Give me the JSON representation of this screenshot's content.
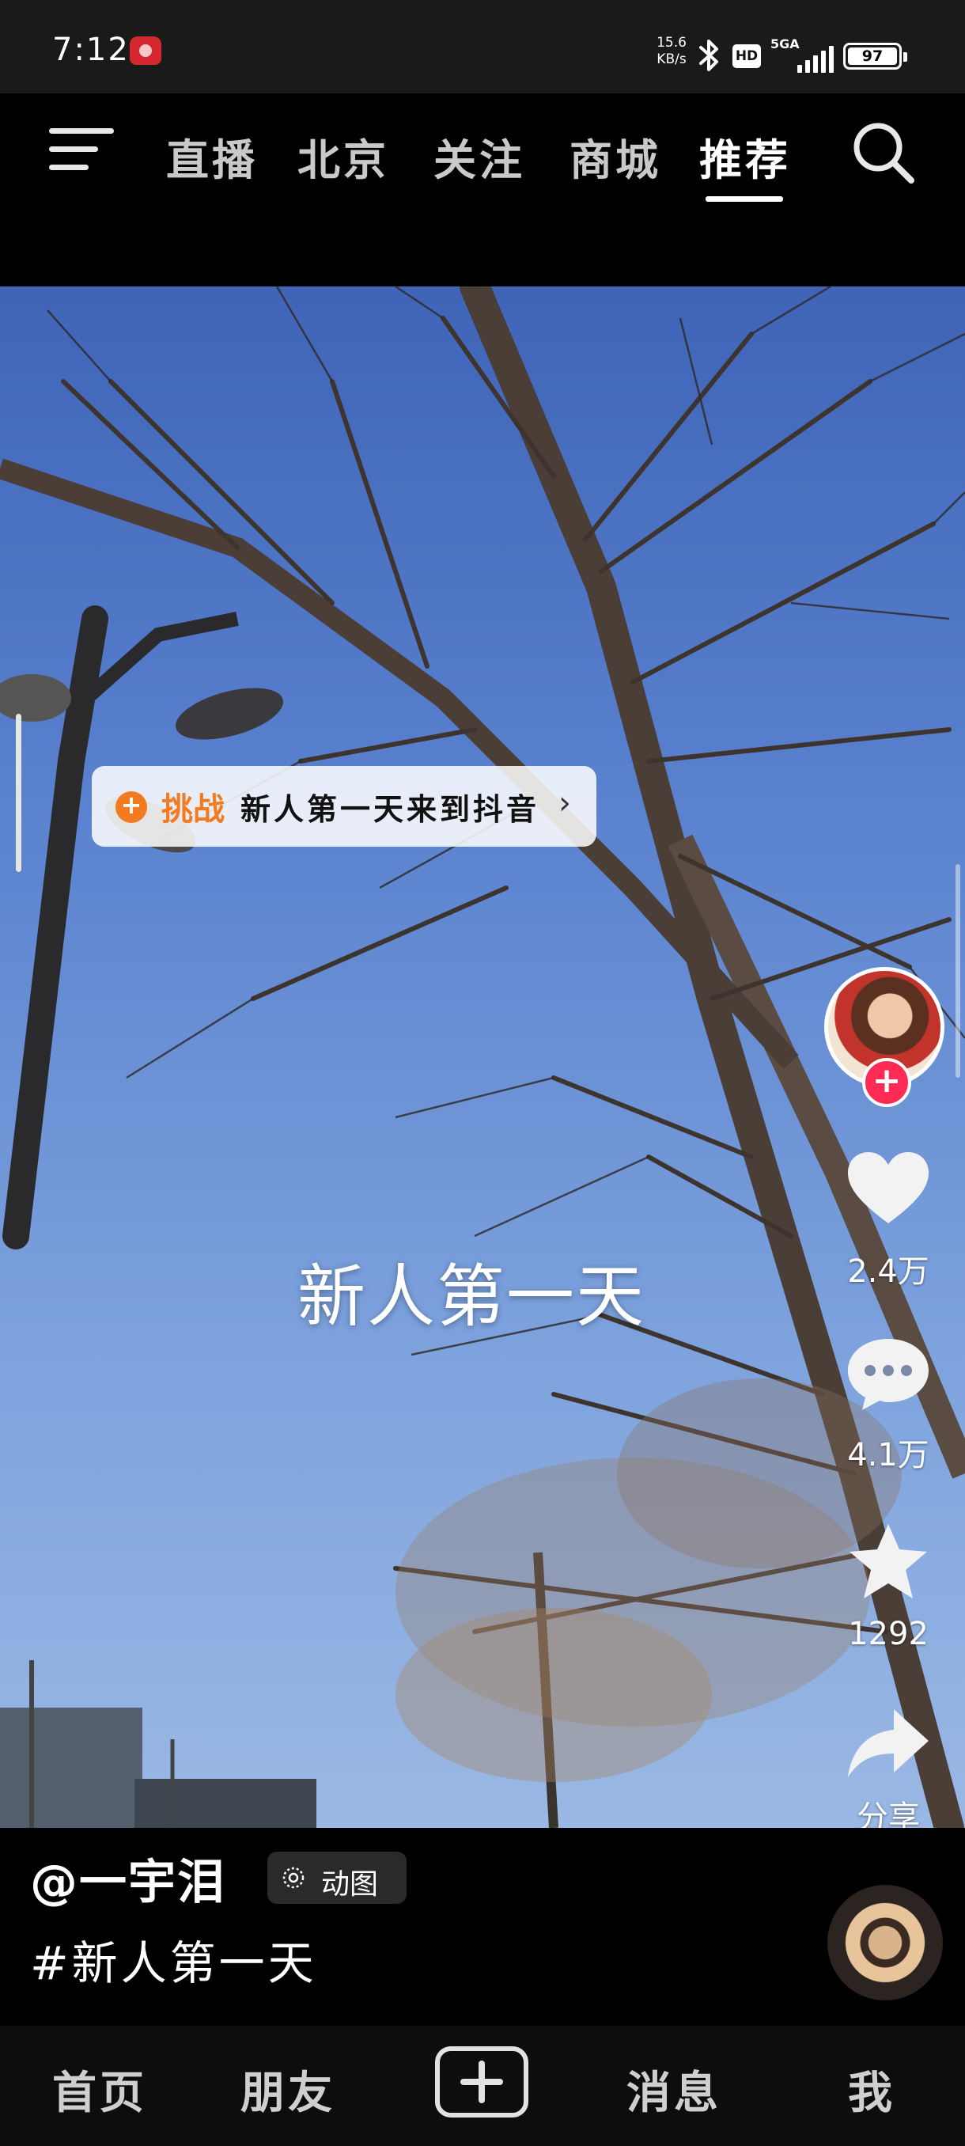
{
  "status_bar": {
    "time": "7:12",
    "net_speed_value": "15.6",
    "net_speed_unit": "KB/s",
    "hd_label": "HD",
    "signal_label": "5GA",
    "battery": "97",
    "icons": [
      "app-notification-icon",
      "bluetooth-icon",
      "signal-icon",
      "battery-icon"
    ]
  },
  "top_nav": {
    "tabs": [
      {
        "label": "直播"
      },
      {
        "label": "北京"
      },
      {
        "label": "关注"
      },
      {
        "label": "商城"
      },
      {
        "label": "推荐"
      }
    ],
    "active_tab": "推荐",
    "icons": [
      "menu-icon",
      "search-icon"
    ]
  },
  "video": {
    "challenge": {
      "tag": "挑战",
      "text": "新人第一天来到抖音",
      "arrow": "›"
    },
    "caption": "新人第一天"
  },
  "actions": {
    "follow": "+",
    "likes": "2.4万",
    "comments": "4.1万",
    "favorites": "1292",
    "share": "分享"
  },
  "info": {
    "username": "@一宇泪",
    "badge": "动图",
    "hashtag": "#新人第一天"
  },
  "bottom_nav": {
    "items": [
      {
        "label": "首页"
      },
      {
        "label": "朋友"
      },
      {
        "label": "消息"
      },
      {
        "label": "我"
      }
    ]
  },
  "colors": {
    "accent_follow": "#fe2c55",
    "challenge_orange": "#f27a20",
    "sky_blue": "#5b83cf"
  }
}
